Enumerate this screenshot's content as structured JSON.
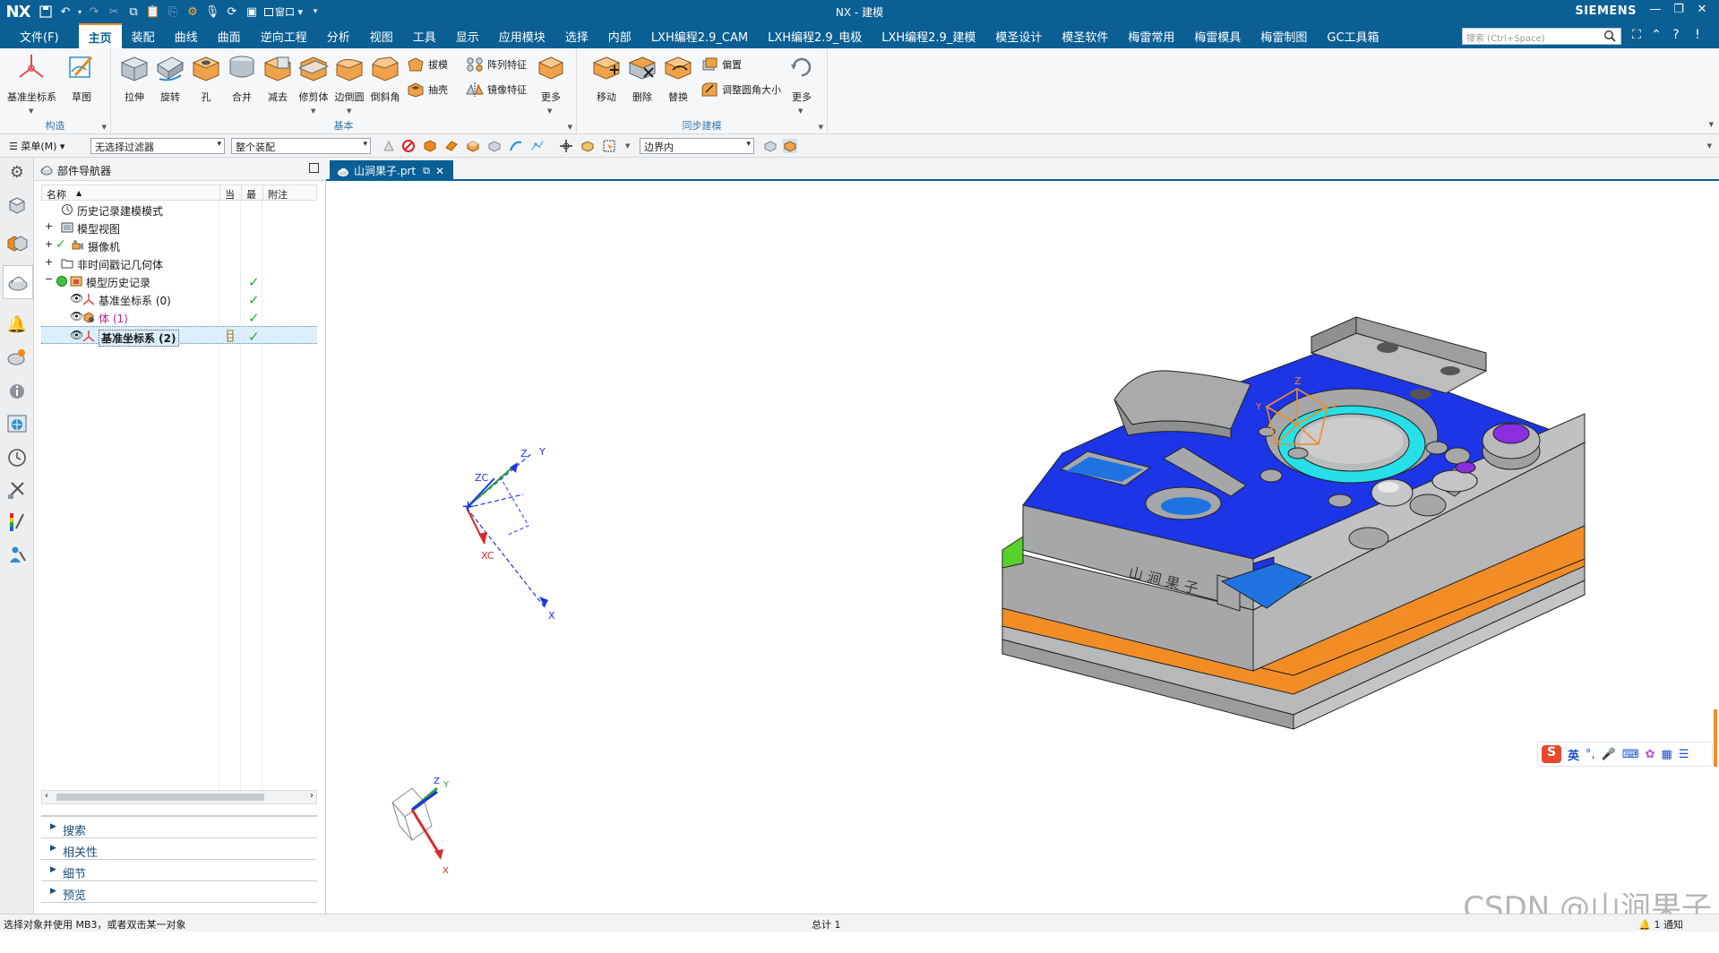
{
  "app": {
    "logo": "NX",
    "window_title": "NX - 建模",
    "brand": "SIEMENS"
  },
  "menu": {
    "file": "文件(F)",
    "tabs": [
      "主页",
      "装配",
      "曲线",
      "曲面",
      "逆向工程",
      "分析",
      "视图",
      "工具",
      "显示",
      "应用模块",
      "选择",
      "内部",
      "LXH编程2.9_CAM",
      "LXH编程2.9_电极",
      "LXH编程2.9_建模",
      "模圣设计",
      "模圣软件",
      "梅雷常用",
      "梅雷模具",
      "梅雷制图",
      "GC工具箱"
    ],
    "active_tab": "主页",
    "search_placeholder": "搜索 (Ctrl+Space)",
    "window_menu": "窗口"
  },
  "ribbon": {
    "groups": {
      "construct": "构造",
      "basic": "基本",
      "sync": "同步建模"
    },
    "construct_buttons": [
      "基准坐标系",
      "草图"
    ],
    "basic_buttons": [
      "拉伸",
      "旋转",
      "孔",
      "合并",
      "减去",
      "修剪体",
      "边倒圆",
      "倒斜角"
    ],
    "basic_small": [
      "拔模",
      "阵列特征",
      "抽壳",
      "镜像特征"
    ],
    "basic_more": "更多",
    "sync_buttons": [
      "移动",
      "删除",
      "替换"
    ],
    "sync_small": [
      "偏置",
      "调整圆角大小"
    ],
    "sync_more": "更多"
  },
  "selection_bar": {
    "menu": "菜单(M)",
    "filter": "无选择过滤器",
    "scope": "整个装配",
    "boundary": "边界内"
  },
  "navigator": {
    "title": "部件导航器",
    "columns": {
      "name": "名称",
      "current": "当",
      "latest": "最",
      "notes": "附注"
    },
    "rows": [
      {
        "label": "历史记录建模模式",
        "check": false
      },
      {
        "label": "模型视图",
        "check": false
      },
      {
        "label": "摄像机",
        "check": false
      },
      {
        "label": "非时间戳记几何体",
        "check": false
      },
      {
        "label": "模型历史记录",
        "check": true
      },
      {
        "label": "基准坐标系 (0)",
        "check": true
      },
      {
        "label": "体 (1)",
        "check": true
      },
      {
        "label": "基准坐标系 (2)",
        "check": true
      }
    ],
    "sections": [
      "搜索",
      "相关性",
      "细节",
      "预览"
    ]
  },
  "document": {
    "tab_label": "山涧果子.prt"
  },
  "viewport": {
    "csys_labels": {
      "x": "X",
      "y": "Y",
      "z": "Z",
      "xc": "XC",
      "zc": "ZC"
    },
    "colors": {
      "blue_face": "#1c35e6",
      "gray_face": "#a6a7a9",
      "orange_plate": "#f28d25",
      "cyan_ring": "#27dfe8",
      "purple": "#8a2ee0",
      "green_face": "#56d22a",
      "accent": "#0a5f95"
    }
  },
  "ime": {
    "lang": "英"
  },
  "status": {
    "message": "选择对象并使用 MB3，或者双击某一对象",
    "total": "总计 1",
    "notifications": "1 通知"
  },
  "watermark": "CSDN @山涧果子"
}
